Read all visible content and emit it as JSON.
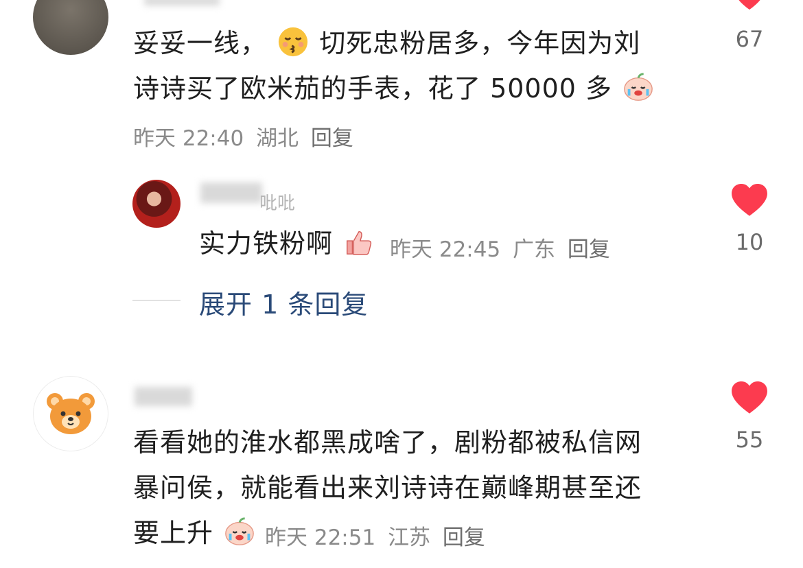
{
  "comments": [
    {
      "text_line1": "妥妥一线，",
      "text_line1b": "切死忠粉居多，今年因为刘",
      "text_line2": "诗诗买了欧米茄的手表，花了 50000 多",
      "meta_time": "昨天 22:40",
      "meta_location": "湖北",
      "reply_label": "回复",
      "likes": "67",
      "emoji_1": "kissing-face-icon",
      "emoji_2": "crying-peach-icon"
    },
    {
      "username_visible": "吡吡",
      "text": "实力铁粉啊",
      "meta_time": "昨天 22:45",
      "meta_location": "广东",
      "reply_label": "回复",
      "likes": "10",
      "emoji": "thumbs-up-icon"
    },
    {
      "expand_label": "展开 1 条回复"
    },
    {
      "text_line1": "看看她的淮水都黑成啥了，剧粉都被私信网",
      "text_line2": "暴问侯，就能看出来刘诗诗在巅峰期甚至还",
      "text_line3": "要上升",
      "meta_time": "昨天 22:51",
      "meta_location": "江苏",
      "reply_label": "回复",
      "likes": "55",
      "emoji": "crying-peach-icon"
    }
  ],
  "colors": {
    "heart": "#fc3b4f",
    "link": "#2a4a78",
    "meta": "#8a8a8a"
  }
}
